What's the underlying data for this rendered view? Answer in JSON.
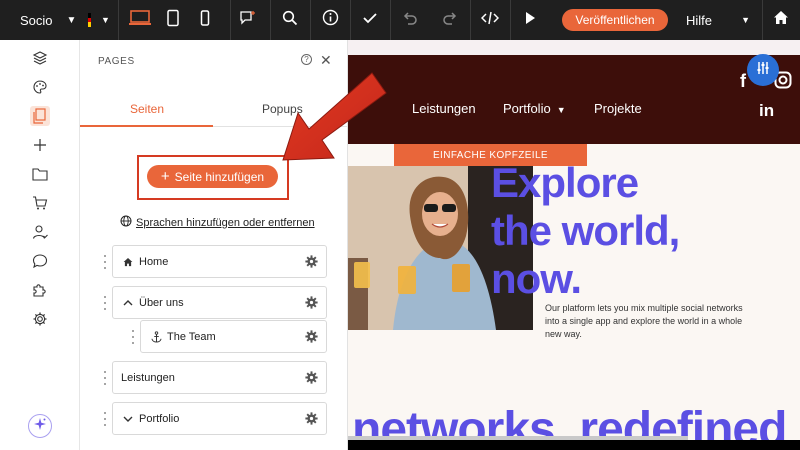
{
  "topbar": {
    "site_name": "Socio",
    "publish_label": "Veröffentlichen",
    "help_label": "Hilfe",
    "flag_colors": [
      "#000000",
      "#dd0000",
      "#ffce00"
    ],
    "icons": [
      "desktop-icon",
      "tablet-icon",
      "mobile-icon",
      "comment-add-icon",
      "search-icon",
      "info-icon",
      "check-icon",
      "undo-icon",
      "redo-icon",
      "code-icon",
      "play-icon",
      "home-icon"
    ]
  },
  "rail": {
    "icons": [
      "layers-icon",
      "palette-icon",
      "pages-icon",
      "add-icon",
      "folder-icon",
      "cart-icon",
      "user-icon",
      "chat-icon",
      "puzzle-icon",
      "settings-icon",
      "ai-sparkle-icon"
    ],
    "active": "pages-icon"
  },
  "panel": {
    "title": "PAGES",
    "tabs": {
      "pages": "Seiten",
      "popups": "Popups"
    },
    "add_page_label": "Seite hinzufügen",
    "languages_link": "Sprachen hinzufügen oder entfernen",
    "pages": [
      {
        "label": "Home",
        "icon": "home-icon"
      },
      {
        "label": "Über uns",
        "icon": "chevron-up-icon"
      },
      {
        "label": "The Team",
        "icon": "anchor-icon"
      },
      {
        "label": "Leistungen",
        "icon": ""
      },
      {
        "label": "Portfolio",
        "icon": "chevron-down-icon"
      }
    ]
  },
  "canvas": {
    "nav": [
      "Leistungen",
      "Portfolio",
      "Projekte"
    ],
    "header_label": "EINFACHE KOPFZEILE",
    "hero_lines": [
      "Explore",
      "the world,",
      "now."
    ],
    "hero_description": "Our platform lets you mix multiple social networks into a single app and explore the world in a whole new way.",
    "bottom_text": "networks, redefined",
    "social": [
      "f",
      "in"
    ]
  },
  "colors": {
    "accent": "#e9663a",
    "hero": "#5b4fe3",
    "header_bg": "#3d0e0a",
    "annotation": "#d53a22"
  }
}
